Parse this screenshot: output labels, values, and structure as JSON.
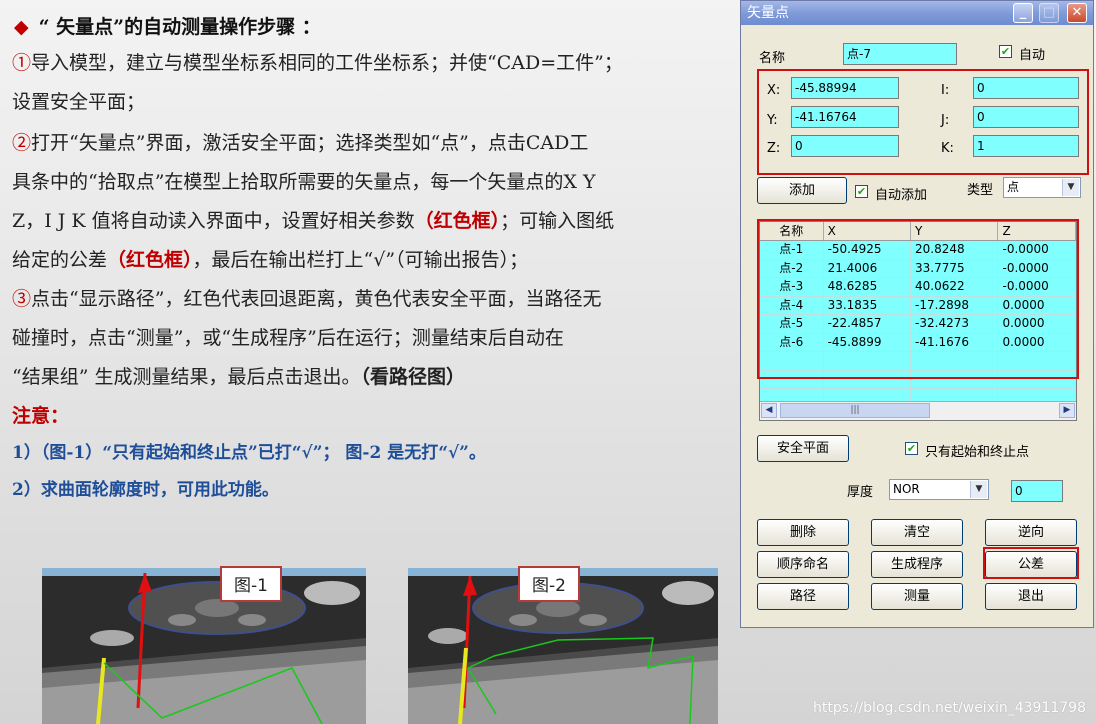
{
  "slide": {
    "title": "“ 矢量点”的自动测量操作步骤 ：",
    "lines": [
      [
        "①",
        "导入模型，建立与模型坐标系相同的工件坐标系；并使“CAD=工件”；"
      ],
      [
        "",
        "设置安全平面；"
      ],
      [
        "②",
        "打开“矢量点”界面，激活安全平面；选择类型如“点”，点击CAD工"
      ],
      [
        "",
        "具条中的“拾取点”在模型上拾取所需要的矢量点，每一个矢量点的X Y"
      ],
      [
        "",
        "Z，I J K 值将自动读入界面中，设置好相关参数"
      ],
      [
        "",
        "给定的公差"
      ],
      [
        "③",
        "点击“显示路径”，红色代表回退距离，黄色代表安全平面，当路径无"
      ],
      [
        "",
        "碰撞时，点击“测量”，或“生成程序”后在运行；测量结束后自动在"
      ],
      [
        "",
        "“结果组” 生成测量结果，最后点击退出。"
      ]
    ],
    "red_box_1": "（红色框）",
    "line5_tail": "；可输入图纸",
    "red_box_2": "（红色框）",
    "line6_tail": "，最后在输出栏打上“√”（可输出报告）；",
    "see_path": "（看路径图）",
    "note_label": "注意：",
    "note_1": "1）（图-1）“只有起始和终止点”已打“√”； 图-2 是无打“√”。",
    "note_2": "2）求曲面轮廓度时，可用此功能。",
    "fig1_label": "图-1",
    "fig2_label": "图-2",
    "watermark": "https://blog.csdn.net/weixin_43911798"
  },
  "dialog": {
    "title": "矢量点",
    "name_label": "名称",
    "name_value": "点-7",
    "auto_label": "自动",
    "x_label": "X:",
    "x_value": "-45.88994",
    "y_label": "Y:",
    "y_value": "-41.16764",
    "z_label": "Z:",
    "z_value": "0",
    "i_label": "I:",
    "i_value": "0",
    "j_label": "J:",
    "j_value": "0",
    "k_label": "K:",
    "k_value": "1",
    "add_button": "添加",
    "auto_add_label": "自动添加",
    "type_label": "类型",
    "type_value": "点",
    "table": {
      "headers": [
        "名称",
        "X",
        "Y",
        "Z"
      ],
      "rows": [
        [
          "点-1",
          "-50.4925",
          "20.8248",
          "-0.0000"
        ],
        [
          "点-2",
          "21.4006",
          "33.7775",
          "-0.0000"
        ],
        [
          "点-3",
          "48.6285",
          "40.0622",
          "-0.0000"
        ],
        [
          "点-4",
          "33.1835",
          "-17.2898",
          "0.0000"
        ],
        [
          "点-5",
          "-22.4857",
          "-32.4273",
          "0.0000"
        ],
        [
          "点-6",
          "-45.8899",
          "-41.1676",
          "0.0000"
        ]
      ]
    },
    "safe_plane_button": "安全平面",
    "start_end_label": "只有起始和终止点",
    "thickness_label": "厚度",
    "thickness_mode": "NOR",
    "thickness_value": "0",
    "buttons": {
      "delete": "删除",
      "clear": "清空",
      "reverse": "逆向",
      "seq_name": "顺序命名",
      "gen_prog": "生成程序",
      "tolerance": "公差",
      "path": "路径",
      "measure": "测量",
      "exit": "退出"
    }
  }
}
